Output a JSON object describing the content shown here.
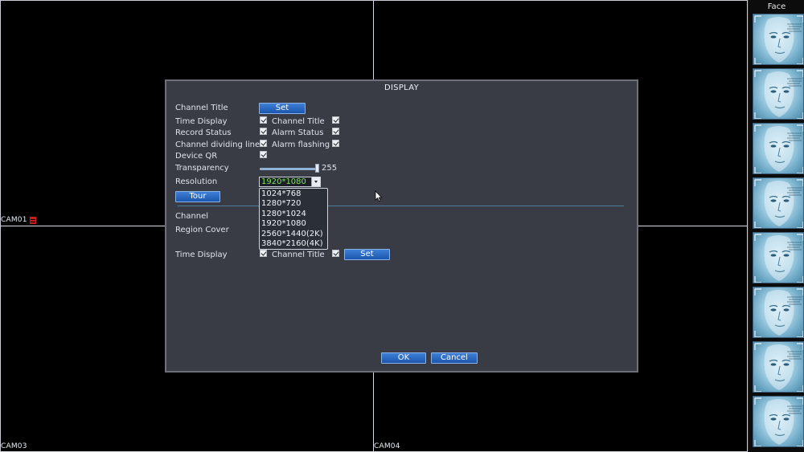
{
  "cameras": [
    {
      "label": "CAM01"
    },
    {
      "label": "CAM03"
    },
    {
      "label": "CAM04"
    }
  ],
  "face_panel": {
    "title": "Face",
    "icon": "face-recognition-icon",
    "card_count": 8
  },
  "dialog": {
    "title": "DISPLAY",
    "labels": {
      "channel_title": "Channel Title",
      "time_display": "Time Display",
      "channel_title_2": "Channel Title",
      "record_status": "Record Status",
      "alarm_status": "Alarm Status",
      "channel_dividing_line": "Channel dividing line",
      "alarm_flashing": "Alarm flashing",
      "device_qr": "Device QR",
      "transparency": "Transparency",
      "resolution": "Resolution",
      "channel": "Channel",
      "region_cover": "Region Cover",
      "time_display_2": "Time Display",
      "channel_title_3": "Channel Title"
    },
    "transparency_value": "255",
    "resolution": {
      "selected": "1920*1080",
      "options": [
        "1024*768",
        "1280*720",
        "1280*1024",
        "1920*1080",
        "2560*1440(2K)",
        "3840*2160(4K)"
      ]
    },
    "buttons": {
      "set": "Set",
      "tour": "Tour",
      "set_2": "Set",
      "ok": "OK",
      "cancel": "Cancel"
    }
  },
  "colors": {
    "dialog_bg": "#3a3c45",
    "button_blue": "#1b56ad",
    "selected_text": "#7fe35a",
    "record_icon": "#c81e1e"
  }
}
